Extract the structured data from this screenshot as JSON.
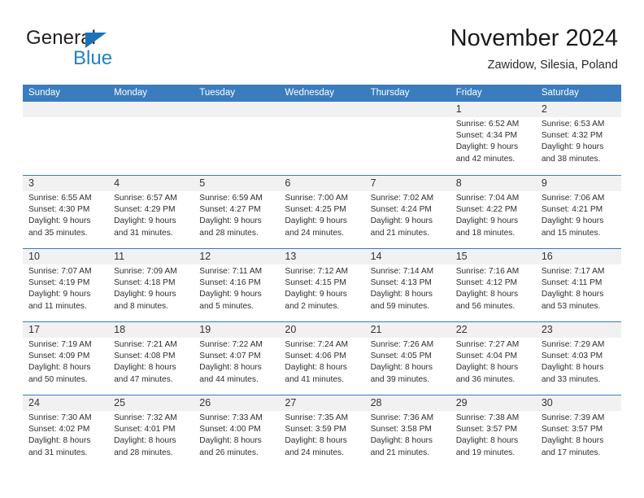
{
  "brand": {
    "name_part1": "General",
    "name_part2": "Blue",
    "accent_color": "#1f82c8",
    "triangle_color": "#1b72b8"
  },
  "header": {
    "title": "November 2024",
    "subtitle": "Zawidow, Silesia, Poland",
    "header_bg_color": "#3a7cbe",
    "day_band_color": "#f1f1f1"
  },
  "weekdays": [
    "Sunday",
    "Monday",
    "Tuesday",
    "Wednesday",
    "Thursday",
    "Friday",
    "Saturday"
  ],
  "weeks": [
    [
      {
        "day": "",
        "sunrise": "",
        "sunset": "",
        "daylight_line1": "",
        "daylight_line2": ""
      },
      {
        "day": "",
        "sunrise": "",
        "sunset": "",
        "daylight_line1": "",
        "daylight_line2": ""
      },
      {
        "day": "",
        "sunrise": "",
        "sunset": "",
        "daylight_line1": "",
        "daylight_line2": ""
      },
      {
        "day": "",
        "sunrise": "",
        "sunset": "",
        "daylight_line1": "",
        "daylight_line2": ""
      },
      {
        "day": "",
        "sunrise": "",
        "sunset": "",
        "daylight_line1": "",
        "daylight_line2": ""
      },
      {
        "day": "1",
        "sunrise": "Sunrise: 6:52 AM",
        "sunset": "Sunset: 4:34 PM",
        "daylight_line1": "Daylight: 9 hours",
        "daylight_line2": "and 42 minutes."
      },
      {
        "day": "2",
        "sunrise": "Sunrise: 6:53 AM",
        "sunset": "Sunset: 4:32 PM",
        "daylight_line1": "Daylight: 9 hours",
        "daylight_line2": "and 38 minutes."
      }
    ],
    [
      {
        "day": "3",
        "sunrise": "Sunrise: 6:55 AM",
        "sunset": "Sunset: 4:30 PM",
        "daylight_line1": "Daylight: 9 hours",
        "daylight_line2": "and 35 minutes."
      },
      {
        "day": "4",
        "sunrise": "Sunrise: 6:57 AM",
        "sunset": "Sunset: 4:29 PM",
        "daylight_line1": "Daylight: 9 hours",
        "daylight_line2": "and 31 minutes."
      },
      {
        "day": "5",
        "sunrise": "Sunrise: 6:59 AM",
        "sunset": "Sunset: 4:27 PM",
        "daylight_line1": "Daylight: 9 hours",
        "daylight_line2": "and 28 minutes."
      },
      {
        "day": "6",
        "sunrise": "Sunrise: 7:00 AM",
        "sunset": "Sunset: 4:25 PM",
        "daylight_line1": "Daylight: 9 hours",
        "daylight_line2": "and 24 minutes."
      },
      {
        "day": "7",
        "sunrise": "Sunrise: 7:02 AM",
        "sunset": "Sunset: 4:24 PM",
        "daylight_line1": "Daylight: 9 hours",
        "daylight_line2": "and 21 minutes."
      },
      {
        "day": "8",
        "sunrise": "Sunrise: 7:04 AM",
        "sunset": "Sunset: 4:22 PM",
        "daylight_line1": "Daylight: 9 hours",
        "daylight_line2": "and 18 minutes."
      },
      {
        "day": "9",
        "sunrise": "Sunrise: 7:06 AM",
        "sunset": "Sunset: 4:21 PM",
        "daylight_line1": "Daylight: 9 hours",
        "daylight_line2": "and 15 minutes."
      }
    ],
    [
      {
        "day": "10",
        "sunrise": "Sunrise: 7:07 AM",
        "sunset": "Sunset: 4:19 PM",
        "daylight_line1": "Daylight: 9 hours",
        "daylight_line2": "and 11 minutes."
      },
      {
        "day": "11",
        "sunrise": "Sunrise: 7:09 AM",
        "sunset": "Sunset: 4:18 PM",
        "daylight_line1": "Daylight: 9 hours",
        "daylight_line2": "and 8 minutes."
      },
      {
        "day": "12",
        "sunrise": "Sunrise: 7:11 AM",
        "sunset": "Sunset: 4:16 PM",
        "daylight_line1": "Daylight: 9 hours",
        "daylight_line2": "and 5 minutes."
      },
      {
        "day": "13",
        "sunrise": "Sunrise: 7:12 AM",
        "sunset": "Sunset: 4:15 PM",
        "daylight_line1": "Daylight: 9 hours",
        "daylight_line2": "and 2 minutes."
      },
      {
        "day": "14",
        "sunrise": "Sunrise: 7:14 AM",
        "sunset": "Sunset: 4:13 PM",
        "daylight_line1": "Daylight: 8 hours",
        "daylight_line2": "and 59 minutes."
      },
      {
        "day": "15",
        "sunrise": "Sunrise: 7:16 AM",
        "sunset": "Sunset: 4:12 PM",
        "daylight_line1": "Daylight: 8 hours",
        "daylight_line2": "and 56 minutes."
      },
      {
        "day": "16",
        "sunrise": "Sunrise: 7:17 AM",
        "sunset": "Sunset: 4:11 PM",
        "daylight_line1": "Daylight: 8 hours",
        "daylight_line2": "and 53 minutes."
      }
    ],
    [
      {
        "day": "17",
        "sunrise": "Sunrise: 7:19 AM",
        "sunset": "Sunset: 4:09 PM",
        "daylight_line1": "Daylight: 8 hours",
        "daylight_line2": "and 50 minutes."
      },
      {
        "day": "18",
        "sunrise": "Sunrise: 7:21 AM",
        "sunset": "Sunset: 4:08 PM",
        "daylight_line1": "Daylight: 8 hours",
        "daylight_line2": "and 47 minutes."
      },
      {
        "day": "19",
        "sunrise": "Sunrise: 7:22 AM",
        "sunset": "Sunset: 4:07 PM",
        "daylight_line1": "Daylight: 8 hours",
        "daylight_line2": "and 44 minutes."
      },
      {
        "day": "20",
        "sunrise": "Sunrise: 7:24 AM",
        "sunset": "Sunset: 4:06 PM",
        "daylight_line1": "Daylight: 8 hours",
        "daylight_line2": "and 41 minutes."
      },
      {
        "day": "21",
        "sunrise": "Sunrise: 7:26 AM",
        "sunset": "Sunset: 4:05 PM",
        "daylight_line1": "Daylight: 8 hours",
        "daylight_line2": "and 39 minutes."
      },
      {
        "day": "22",
        "sunrise": "Sunrise: 7:27 AM",
        "sunset": "Sunset: 4:04 PM",
        "daylight_line1": "Daylight: 8 hours",
        "daylight_line2": "and 36 minutes."
      },
      {
        "day": "23",
        "sunrise": "Sunrise: 7:29 AM",
        "sunset": "Sunset: 4:03 PM",
        "daylight_line1": "Daylight: 8 hours",
        "daylight_line2": "and 33 minutes."
      }
    ],
    [
      {
        "day": "24",
        "sunrise": "Sunrise: 7:30 AM",
        "sunset": "Sunset: 4:02 PM",
        "daylight_line1": "Daylight: 8 hours",
        "daylight_line2": "and 31 minutes."
      },
      {
        "day": "25",
        "sunrise": "Sunrise: 7:32 AM",
        "sunset": "Sunset: 4:01 PM",
        "daylight_line1": "Daylight: 8 hours",
        "daylight_line2": "and 28 minutes."
      },
      {
        "day": "26",
        "sunrise": "Sunrise: 7:33 AM",
        "sunset": "Sunset: 4:00 PM",
        "daylight_line1": "Daylight: 8 hours",
        "daylight_line2": "and 26 minutes."
      },
      {
        "day": "27",
        "sunrise": "Sunrise: 7:35 AM",
        "sunset": "Sunset: 3:59 PM",
        "daylight_line1": "Daylight: 8 hours",
        "daylight_line2": "and 24 minutes."
      },
      {
        "day": "28",
        "sunrise": "Sunrise: 7:36 AM",
        "sunset": "Sunset: 3:58 PM",
        "daylight_line1": "Daylight: 8 hours",
        "daylight_line2": "and 21 minutes."
      },
      {
        "day": "29",
        "sunrise": "Sunrise: 7:38 AM",
        "sunset": "Sunset: 3:57 PM",
        "daylight_line1": "Daylight: 8 hours",
        "daylight_line2": "and 19 minutes."
      },
      {
        "day": "30",
        "sunrise": "Sunrise: 7:39 AM",
        "sunset": "Sunset: 3:57 PM",
        "daylight_line1": "Daylight: 8 hours",
        "daylight_line2": "and 17 minutes."
      }
    ]
  ]
}
